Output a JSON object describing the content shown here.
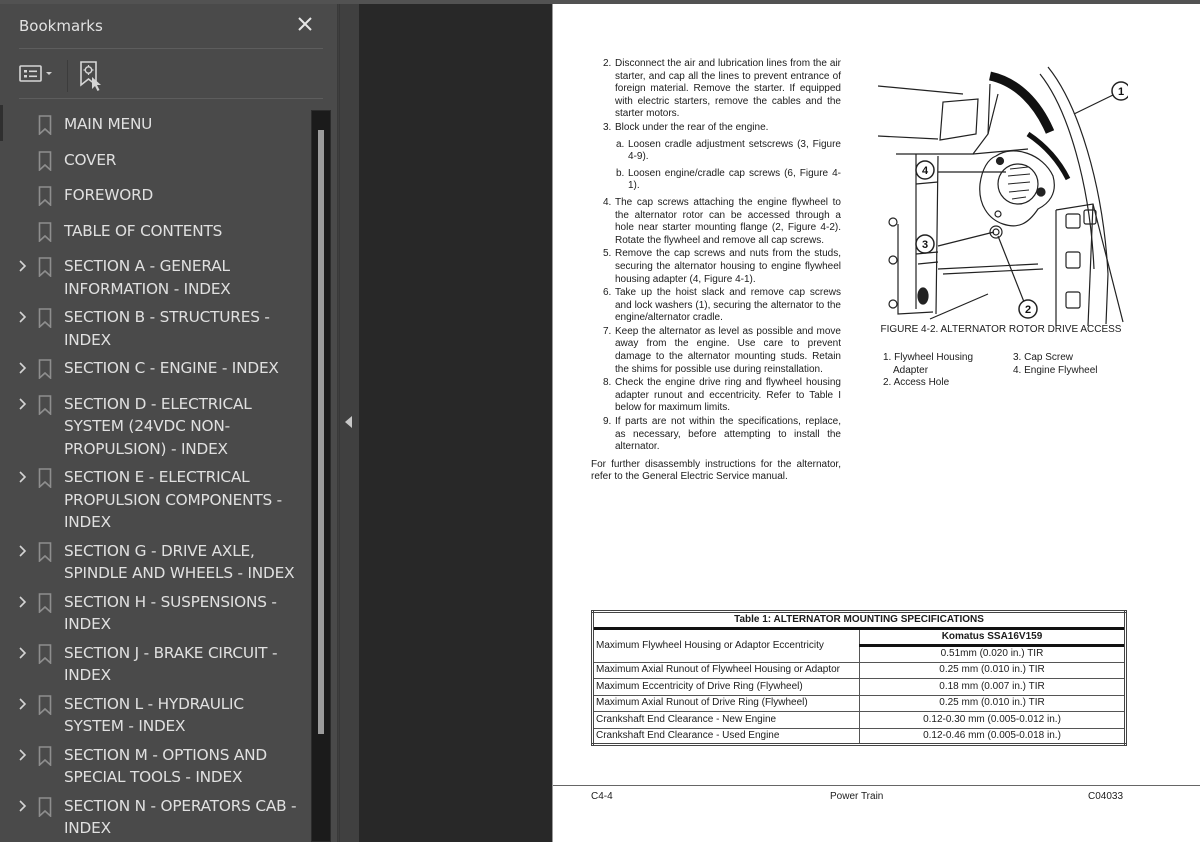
{
  "bookmarks_panel": {
    "title": "Bookmarks",
    "close_icon": "close-icon",
    "options_icon": "bookmark-options-icon",
    "find_icon": "find-current-bookmark-icon",
    "items": [
      {
        "label": "MAIN MENU",
        "expandable": false,
        "selected": true
      },
      {
        "label": "COVER",
        "expandable": false
      },
      {
        "label": "FOREWORD",
        "expandable": false
      },
      {
        "label": "TABLE OF CONTENTS",
        "expandable": false
      },
      {
        "label": "SECTION A - GENERAL INFORMATION - INDEX",
        "expandable": true
      },
      {
        "label": "SECTION B - STRUCTURES - INDEX",
        "expandable": true
      },
      {
        "label": "SECTION C - ENGINE - INDEX",
        "expandable": true
      },
      {
        "label": "SECTION D - ELECTRICAL SYSTEM (24VDC NON-PROPULSION) - INDEX",
        "expandable": true
      },
      {
        "label": "SECTION E - ELECTRICAL PROPULSION COMPONENTS - INDEX",
        "expandable": true
      },
      {
        "label": "SECTION G - DRIVE AXLE, SPINDLE AND WHEELS - INDEX",
        "expandable": true
      },
      {
        "label": "SECTION H - SUSPENSIONS - INDEX",
        "expandable": true
      },
      {
        "label": "SECTION J - BRAKE CIRCUIT - INDEX",
        "expandable": true
      },
      {
        "label": "SECTION L - HYDRAULIC SYSTEM - INDEX",
        "expandable": true
      },
      {
        "label": "SECTION M - OPTIONS AND SPECIAL TOOLS - INDEX",
        "expandable": true
      },
      {
        "label": "SECTION N - OPERATORS CAB - INDEX",
        "expandable": true
      }
    ]
  },
  "splitter": {
    "icon": "collapse-panel-left-icon"
  },
  "document": {
    "steps": [
      {
        "num": "2.",
        "text": "Disconnect the air and lubrication lines from the air starter, and cap all the lines to prevent entrance of foreign material. Remove the starter. If equipped with electric starters, remove the cables and the starter motors."
      },
      {
        "num": "3.",
        "text": "Block under the rear of the engine."
      }
    ],
    "substeps": [
      {
        "num": "a.",
        "text": "Loosen cradle adjustment setscrews (3, Figure 4-9)."
      },
      {
        "num": "b.",
        "text": "Loosen engine/cradle cap screws (6, Figure 4-1)."
      }
    ],
    "steps2": [
      {
        "num": "4.",
        "text": "The cap screws attaching the engine flywheel to the alternator rotor can be accessed through a hole near starter mounting flange (2, Figure 4-2). Rotate the flywheel and remove all cap screws."
      },
      {
        "num": "5.",
        "text": "Remove the cap screws and nuts from the studs, securing the alternator housing to engine flywheel housing adapter (4, Figure 4-1)."
      },
      {
        "num": "6.",
        "text": "Take up the hoist slack and remove cap screws and lock washers (1), securing the alternator to the engine/alternator cradle."
      },
      {
        "num": "7.",
        "text": "Keep the alternator as level as possible and move away from the engine. Use care to prevent damage to the alternator mounting studs. Retain the shims for possible use during reinstallation."
      },
      {
        "num": "8.",
        "text": "Check the engine drive ring and flywheel housing adapter runout and eccentricity. Refer to Table I below for maximum limits."
      },
      {
        "num": "9.",
        "text": "If parts are not within the specifications, replace, as necessary, before attempting to install the alternator."
      }
    ],
    "closing": "For further disassembly instructions for the alternator, refer to the General Electric Service manual.",
    "figure": {
      "callouts": [
        "1",
        "2",
        "3",
        "4"
      ],
      "caption": "FIGURE 4-2. ALTERNATOR ROTOR DRIVE ACCESS",
      "legend": {
        "item1": "1. Flywheel Housing",
        "item1_cont": "Adapter",
        "item2": "2. Access Hole",
        "item3": "3. Cap Screw",
        "item4": "4. Engine Flywheel"
      }
    },
    "table": {
      "title": "Table 1:    ALTERNATOR MOUNTING SPECIFICATIONS",
      "column_header": "Komatus SSA16V159",
      "rows": [
        {
          "label": "Maximum Flywheel Housing or Adaptor Eccentricity",
          "value": "0.51mm (0.020 in.) TIR"
        },
        {
          "label": "Maximum Axial Runout of Flywheel Housing or Adaptor",
          "value": "0.25 mm (0.010 in.) TIR"
        },
        {
          "label": "Maximum Eccentricity of Drive Ring (Flywheel)",
          "value": "0.18 mm (0.007 in.) TIR"
        },
        {
          "label": "Maximum Axial Runout of Drive Ring (Flywheel)",
          "value": "0.25 mm (0.010 in.) TIR"
        },
        {
          "label": "Crankshaft End Clearance - New Engine",
          "value": "0.12-0.30 mm (0.005-0.012 in.)"
        },
        {
          "label": "Crankshaft End Clearance - Used Engine",
          "value": "0.12-0.46 mm (0.005-0.018 in.)"
        }
      ]
    },
    "footer": {
      "left": "C4-4",
      "center": "Power Train",
      "right": "C04033"
    }
  }
}
